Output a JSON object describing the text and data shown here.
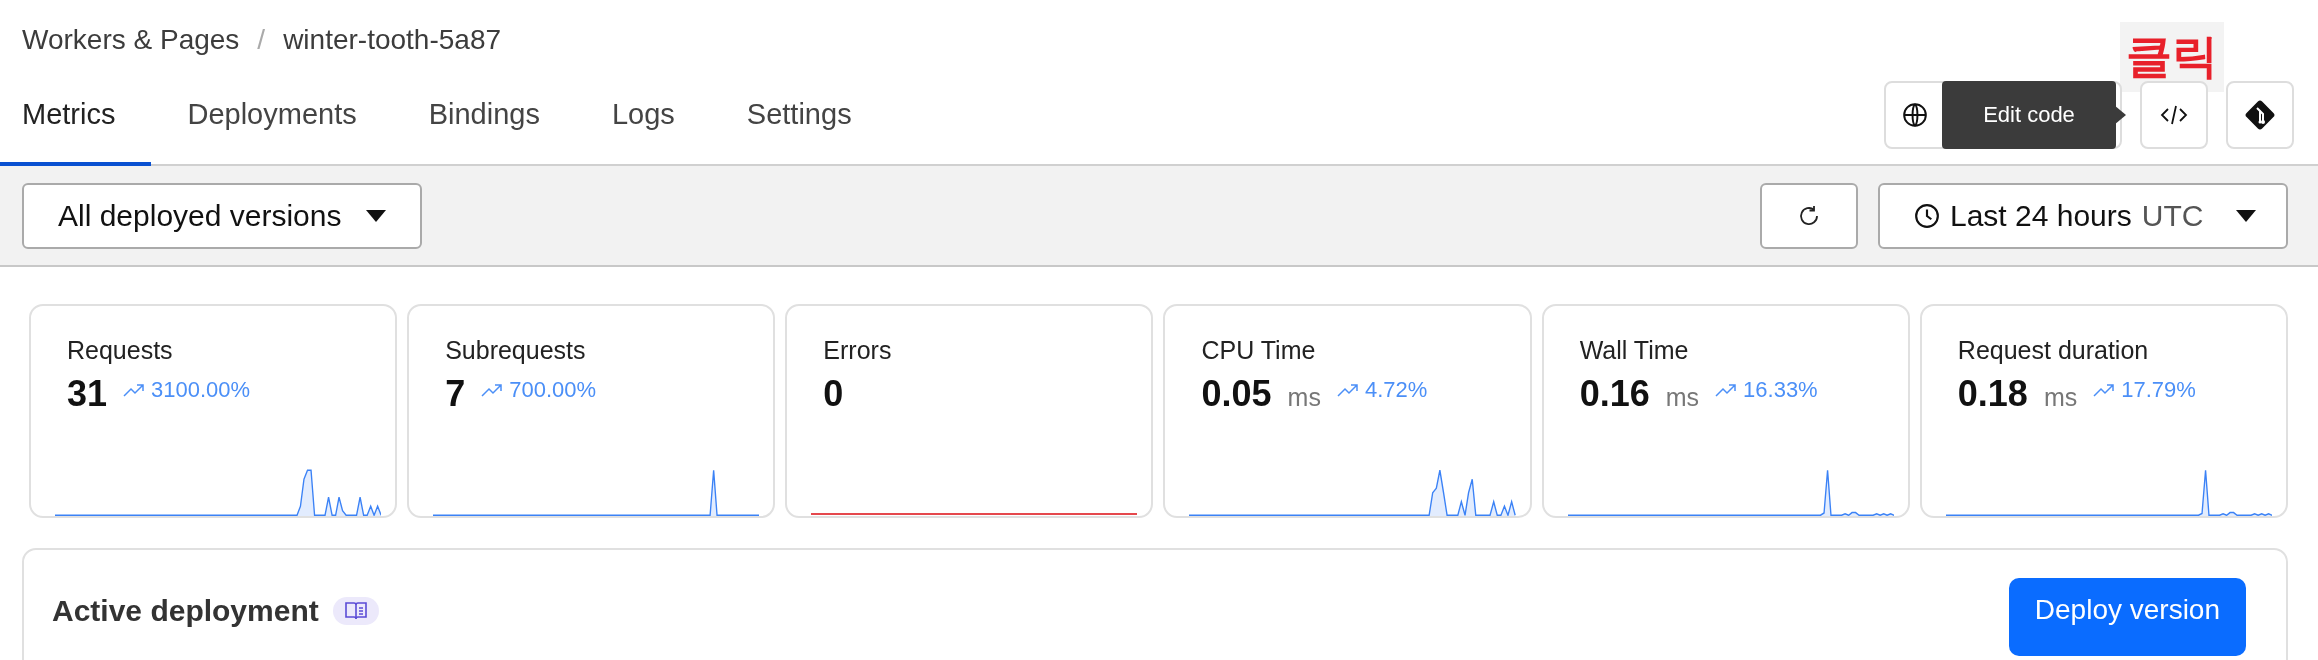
{
  "breadcrumb": [
    "Workers & Pages",
    "/",
    "winter-tooth-5a87"
  ],
  "annotation": "클릭",
  "tabs": [
    {
      "label": "Metrics",
      "selected": true
    },
    {
      "label": "Deployments",
      "selected": false
    },
    {
      "label": "Bindings",
      "selected": false
    },
    {
      "label": "Logs",
      "selected": false
    },
    {
      "label": "Settings",
      "selected": false
    }
  ],
  "tooltip": "Edit code",
  "toolbar": {
    "version_filter": "All deployed versions",
    "time_range": "Last 24 hours",
    "timezone": "UTC"
  },
  "metrics": [
    {
      "title": "Requests",
      "value": "31",
      "change": "3100.00%",
      "color": "#3b82f6"
    },
    {
      "title": "Subrequests",
      "value": "7",
      "change": "700.00%",
      "color": "#3b82f6"
    },
    {
      "title": "Errors",
      "value": "0",
      "color": "#e5484d"
    },
    {
      "title": "CPU Time",
      "value": "0.05",
      "unit": "ms",
      "change": "4.72%",
      "color": "#3b82f6"
    },
    {
      "title": "Wall Time",
      "value": "0.16",
      "unit": "ms",
      "change": "16.33%",
      "color": "#3b82f6"
    },
    {
      "title": "Request duration",
      "value": "0.18",
      "unit": "ms",
      "change": "17.79%",
      "color": "#3b82f6"
    }
  ],
  "deployment": {
    "heading": "Active deployment",
    "button": "Deploy version"
  }
}
